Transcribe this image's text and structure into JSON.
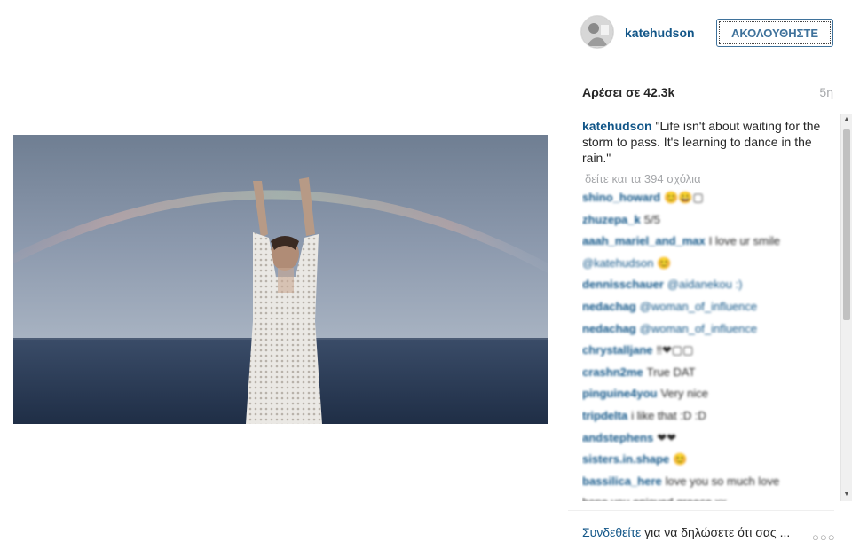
{
  "post": {
    "username": "katehudson",
    "follow_label": "ΑΚΟΛΟΥΘΗΣΤΕ",
    "likes_text": "Αρέσει σε 42.3k",
    "time": "5η",
    "caption_user": "katehudson",
    "caption_text": " \"Life isn't about waiting for the storm to pass. It's learning to dance in the rain.\"",
    "view_all_comments": "δείτε και τα 394 σχόλια"
  },
  "comments": [
    {
      "user": "shino_howard",
      "text": "😊😀▢"
    },
    {
      "user": "zhuzepa_k",
      "text": "5/5"
    },
    {
      "user": "aaah_mariel_and_max",
      "text": "I love ur smile"
    },
    {
      "user": "",
      "text": "@katehudson 😊"
    },
    {
      "user": "dennisschauer",
      "text": "@aidanekou :)"
    },
    {
      "user": "nedachag",
      "text": "@woman_of_influence"
    },
    {
      "user": "nedachag",
      "text": "@woman_of_influence"
    },
    {
      "user": "chrystalljane",
      "text": "‼❤▢▢"
    },
    {
      "user": "crashn2me",
      "text": "True DAT"
    },
    {
      "user": "pinguine4you",
      "text": "Very nice"
    },
    {
      "user": "tripdelta",
      "text": "i like that :D :D"
    },
    {
      "user": "andstephens",
      "text": "❤❤"
    },
    {
      "user": "sisters.in.shape",
      "text": "😊"
    },
    {
      "user": "bassilica_here",
      "text": "love you so much love"
    },
    {
      "user": "",
      "text": "hope you enjoyed greece xx"
    }
  ],
  "footer": {
    "login_link": "Συνδεθείτε",
    "login_rest": " για να δηλώσετε ότι σας ...",
    "more": "○○○"
  },
  "icons": {
    "avatar": "avatar",
    "more": "more-options-icon"
  },
  "colors": {
    "link": "#125688",
    "follow": "#3f729b",
    "muted": "#a5a7aa"
  }
}
